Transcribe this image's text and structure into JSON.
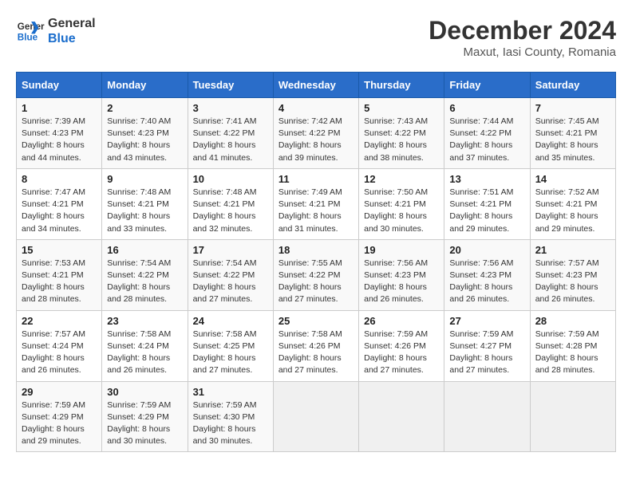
{
  "logo": {
    "line1": "General",
    "line2": "Blue"
  },
  "title": "December 2024",
  "subtitle": "Maxut, Iasi County, Romania",
  "weekdays": [
    "Sunday",
    "Monday",
    "Tuesday",
    "Wednesday",
    "Thursday",
    "Friday",
    "Saturday"
  ],
  "weeks": [
    [
      {
        "day": "1",
        "sunrise": "Sunrise: 7:39 AM",
        "sunset": "Sunset: 4:23 PM",
        "daylight": "Daylight: 8 hours and 44 minutes."
      },
      {
        "day": "2",
        "sunrise": "Sunrise: 7:40 AM",
        "sunset": "Sunset: 4:23 PM",
        "daylight": "Daylight: 8 hours and 43 minutes."
      },
      {
        "day": "3",
        "sunrise": "Sunrise: 7:41 AM",
        "sunset": "Sunset: 4:22 PM",
        "daylight": "Daylight: 8 hours and 41 minutes."
      },
      {
        "day": "4",
        "sunrise": "Sunrise: 7:42 AM",
        "sunset": "Sunset: 4:22 PM",
        "daylight": "Daylight: 8 hours and 39 minutes."
      },
      {
        "day": "5",
        "sunrise": "Sunrise: 7:43 AM",
        "sunset": "Sunset: 4:22 PM",
        "daylight": "Daylight: 8 hours and 38 minutes."
      },
      {
        "day": "6",
        "sunrise": "Sunrise: 7:44 AM",
        "sunset": "Sunset: 4:22 PM",
        "daylight": "Daylight: 8 hours and 37 minutes."
      },
      {
        "day": "7",
        "sunrise": "Sunrise: 7:45 AM",
        "sunset": "Sunset: 4:21 PM",
        "daylight": "Daylight: 8 hours and 35 minutes."
      }
    ],
    [
      {
        "day": "8",
        "sunrise": "Sunrise: 7:47 AM",
        "sunset": "Sunset: 4:21 PM",
        "daylight": "Daylight: 8 hours and 34 minutes."
      },
      {
        "day": "9",
        "sunrise": "Sunrise: 7:48 AM",
        "sunset": "Sunset: 4:21 PM",
        "daylight": "Daylight: 8 hours and 33 minutes."
      },
      {
        "day": "10",
        "sunrise": "Sunrise: 7:48 AM",
        "sunset": "Sunset: 4:21 PM",
        "daylight": "Daylight: 8 hours and 32 minutes."
      },
      {
        "day": "11",
        "sunrise": "Sunrise: 7:49 AM",
        "sunset": "Sunset: 4:21 PM",
        "daylight": "Daylight: 8 hours and 31 minutes."
      },
      {
        "day": "12",
        "sunrise": "Sunrise: 7:50 AM",
        "sunset": "Sunset: 4:21 PM",
        "daylight": "Daylight: 8 hours and 30 minutes."
      },
      {
        "day": "13",
        "sunrise": "Sunrise: 7:51 AM",
        "sunset": "Sunset: 4:21 PM",
        "daylight": "Daylight: 8 hours and 29 minutes."
      },
      {
        "day": "14",
        "sunrise": "Sunrise: 7:52 AM",
        "sunset": "Sunset: 4:21 PM",
        "daylight": "Daylight: 8 hours and 29 minutes."
      }
    ],
    [
      {
        "day": "15",
        "sunrise": "Sunrise: 7:53 AM",
        "sunset": "Sunset: 4:21 PM",
        "daylight": "Daylight: 8 hours and 28 minutes."
      },
      {
        "day": "16",
        "sunrise": "Sunrise: 7:54 AM",
        "sunset": "Sunset: 4:22 PM",
        "daylight": "Daylight: 8 hours and 28 minutes."
      },
      {
        "day": "17",
        "sunrise": "Sunrise: 7:54 AM",
        "sunset": "Sunset: 4:22 PM",
        "daylight": "Daylight: 8 hours and 27 minutes."
      },
      {
        "day": "18",
        "sunrise": "Sunrise: 7:55 AM",
        "sunset": "Sunset: 4:22 PM",
        "daylight": "Daylight: 8 hours and 27 minutes."
      },
      {
        "day": "19",
        "sunrise": "Sunrise: 7:56 AM",
        "sunset": "Sunset: 4:23 PM",
        "daylight": "Daylight: 8 hours and 26 minutes."
      },
      {
        "day": "20",
        "sunrise": "Sunrise: 7:56 AM",
        "sunset": "Sunset: 4:23 PM",
        "daylight": "Daylight: 8 hours and 26 minutes."
      },
      {
        "day": "21",
        "sunrise": "Sunrise: 7:57 AM",
        "sunset": "Sunset: 4:23 PM",
        "daylight": "Daylight: 8 hours and 26 minutes."
      }
    ],
    [
      {
        "day": "22",
        "sunrise": "Sunrise: 7:57 AM",
        "sunset": "Sunset: 4:24 PM",
        "daylight": "Daylight: 8 hours and 26 minutes."
      },
      {
        "day": "23",
        "sunrise": "Sunrise: 7:58 AM",
        "sunset": "Sunset: 4:24 PM",
        "daylight": "Daylight: 8 hours and 26 minutes."
      },
      {
        "day": "24",
        "sunrise": "Sunrise: 7:58 AM",
        "sunset": "Sunset: 4:25 PM",
        "daylight": "Daylight: 8 hours and 27 minutes."
      },
      {
        "day": "25",
        "sunrise": "Sunrise: 7:58 AM",
        "sunset": "Sunset: 4:26 PM",
        "daylight": "Daylight: 8 hours and 27 minutes."
      },
      {
        "day": "26",
        "sunrise": "Sunrise: 7:59 AM",
        "sunset": "Sunset: 4:26 PM",
        "daylight": "Daylight: 8 hours and 27 minutes."
      },
      {
        "day": "27",
        "sunrise": "Sunrise: 7:59 AM",
        "sunset": "Sunset: 4:27 PM",
        "daylight": "Daylight: 8 hours and 27 minutes."
      },
      {
        "day": "28",
        "sunrise": "Sunrise: 7:59 AM",
        "sunset": "Sunset: 4:28 PM",
        "daylight": "Daylight: 8 hours and 28 minutes."
      }
    ],
    [
      {
        "day": "29",
        "sunrise": "Sunrise: 7:59 AM",
        "sunset": "Sunset: 4:29 PM",
        "daylight": "Daylight: 8 hours and 29 minutes."
      },
      {
        "day": "30",
        "sunrise": "Sunrise: 7:59 AM",
        "sunset": "Sunset: 4:29 PM",
        "daylight": "Daylight: 8 hours and 30 minutes."
      },
      {
        "day": "31",
        "sunrise": "Sunrise: 7:59 AM",
        "sunset": "Sunset: 4:30 PM",
        "daylight": "Daylight: 8 hours and 30 minutes."
      },
      null,
      null,
      null,
      null
    ]
  ]
}
